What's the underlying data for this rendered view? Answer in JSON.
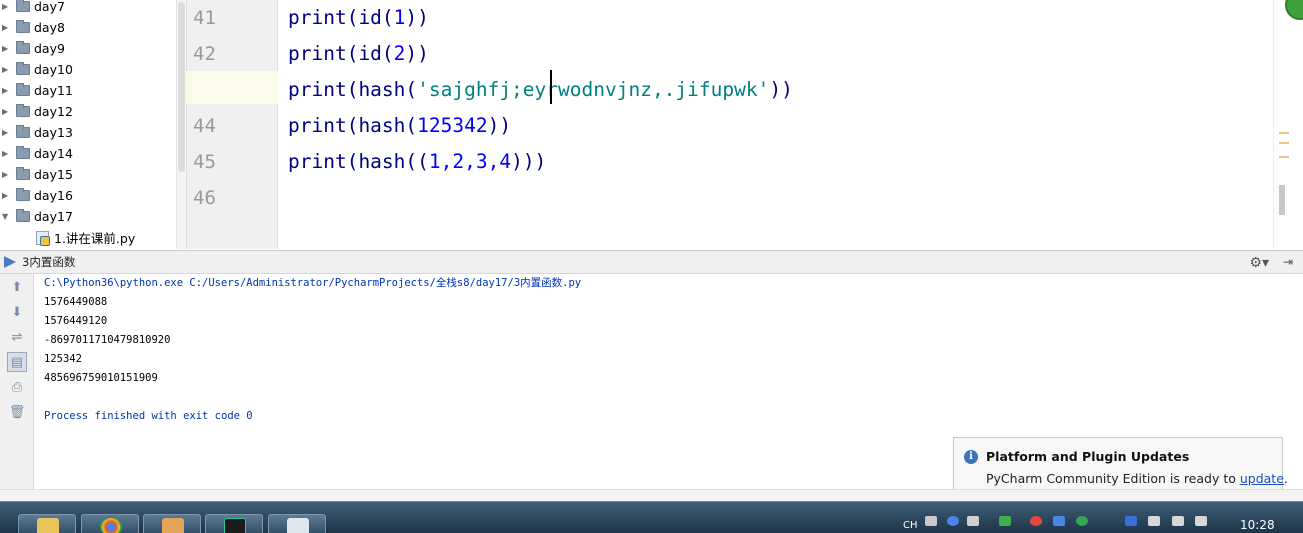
{
  "project_tree": {
    "items": [
      {
        "label": "day7",
        "expanded": false
      },
      {
        "label": "day8",
        "expanded": false
      },
      {
        "label": "day9",
        "expanded": false
      },
      {
        "label": "day10",
        "expanded": false
      },
      {
        "label": "day11",
        "expanded": false
      },
      {
        "label": "day12",
        "expanded": false
      },
      {
        "label": "day13",
        "expanded": false
      },
      {
        "label": "day14",
        "expanded": false
      },
      {
        "label": "day15",
        "expanded": false
      },
      {
        "label": "day16",
        "expanded": false
      },
      {
        "label": "day17",
        "expanded": true
      }
    ],
    "child_file": "1.讲在课前.py"
  },
  "editor": {
    "line_numbers": [
      "41",
      "42",
      "43",
      "44",
      "45",
      "46"
    ],
    "lines": [
      {
        "a": "print(id(",
        "b": "1",
        "c": "))",
        "kind": "num"
      },
      {
        "a": "print(id(",
        "b": "2",
        "c": "))",
        "kind": "num"
      },
      {
        "a": "print(hash(",
        "b": "'sajghfj;eyrwodnvjnz,.jifupwk'",
        "c": "))",
        "kind": "str"
      },
      {
        "a": "print(hash(",
        "b": "125342",
        "c": "))",
        "kind": "num"
      },
      {
        "a": "print(hash((",
        "b": "1,2,3,4",
        "c": ")))",
        "kind": "num"
      },
      {
        "a": "",
        "b": "",
        "c": "",
        "kind": "empty"
      }
    ],
    "current_line": "43",
    "colors": {
      "keyword": "#000080",
      "number": "#0000ff",
      "string": "#008080",
      "current_line": "#fcfae8"
    }
  },
  "run_panel": {
    "title": "3内置函数",
    "toolbar_icons": [
      "up-arrow-icon",
      "down-arrow-icon",
      "soft-wrap-icon",
      "scroll-to-end-icon",
      "print-icon",
      "trash-icon"
    ],
    "console": {
      "command": "C:\\Python36\\python.exe C:/Users/Administrator/PycharmProjects/全栈s8/day17/3内置函数.py",
      "outputs": [
        "1576449088",
        "1576449120",
        "-8697011710479810920",
        "125342",
        "485696759010151909"
      ],
      "exit_message": "Process finished with exit code 0"
    }
  },
  "notification": {
    "title": "Platform and Plugin Updates",
    "body": "PyCharm Community Edition is ready to ",
    "link": "update",
    "tail": "."
  },
  "taskbar": {
    "apps": [
      "file-explorer-icon",
      "chrome-icon",
      "user-app-icon",
      "pycharm-icon",
      "window-app-icon"
    ],
    "ime_label": "CH",
    "clock": "10:28"
  }
}
